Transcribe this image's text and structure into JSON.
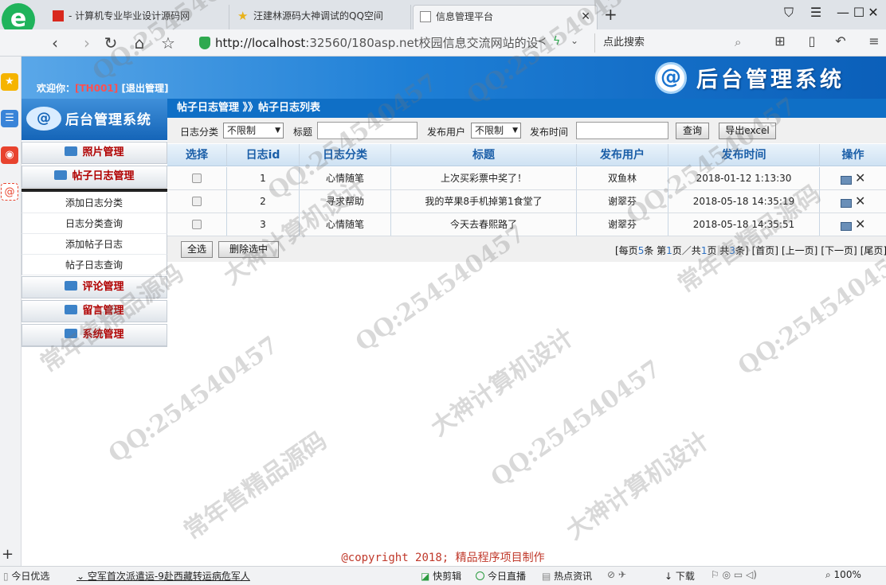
{
  "browser": {
    "tabs": [
      {
        "title": "- 计算机专业毕业设计源码网",
        "color": "#d8281d"
      },
      {
        "title": "汪建林源码大神调试的QQ空间",
        "color": "#e8b21a"
      },
      {
        "title": "信息管理平台",
        "color": "#888888"
      }
    ],
    "new_tab": "+",
    "url_host": "http://localhost",
    "url_rest": ":32560/180asp.net校园信息交流网站的设",
    "search_placeholder": "点此搜索",
    "status_items": [
      "今日优选",
      "空军首次派遣运-9赴西藏转运病危军人",
      "快剪辑",
      "今日直播",
      "热点资讯",
      "下载",
      "100%"
    ]
  },
  "header": {
    "welcome_label": "欢迎你：",
    "username": "[TH001]",
    "logout": "[退出管理]",
    "system_title": "后台管理系统",
    "logo_glyph": "@"
  },
  "sidebar": {
    "logo_title": "后台管理系统",
    "sections": [
      {
        "label": "照片管理",
        "items": []
      },
      {
        "label": "帖子日志管理",
        "items": [
          "添加日志分类",
          "日志分类查询",
          "添加帖子日志",
          "帖子日志查询"
        ]
      },
      {
        "label": "评论管理",
        "items": []
      },
      {
        "label": "留言管理",
        "items": []
      },
      {
        "label": "系统管理",
        "items": []
      }
    ]
  },
  "breadcrumb": "帖子日志管理 》》帖子日志列表",
  "filters": {
    "category_label": "日志分类",
    "category_value": "不限制",
    "title_label": "标题",
    "title_value": "",
    "user_label": "发布用户",
    "user_value": "不限制",
    "time_label": "发布时间",
    "time_value": "",
    "query_button": "查询",
    "export_button": "导出excel"
  },
  "table": {
    "headers": [
      "选择",
      "日志id",
      "日志分类",
      "标题",
      "发布用户",
      "发布时间",
      "操作"
    ],
    "rows": [
      {
        "id": "1",
        "category": "心情随笔",
        "title": "上次买彩票中奖了！",
        "user": "双鱼林",
        "time": "2018-01-12 1:13:30"
      },
      {
        "id": "2",
        "category": "寻求帮助",
        "title": "我的苹果8手机掉第1食堂了",
        "user": "谢翠芬",
        "time": "2018-05-18 14:35:19"
      },
      {
        "id": "3",
        "category": "心情随笔",
        "title": "今天去春熙路了",
        "user": "谢翠芬",
        "time": "2018-05-18 14:35:51"
      }
    ],
    "select_all": "全选",
    "delete_selected": "删除选中",
    "pager": {
      "prefix": "[每页",
      "per_page": "5",
      "mid1": "条 第",
      "current": "1",
      "mid2": "页／共",
      "total_pages": "1",
      "mid3": "页 共",
      "total": "3",
      "suffix": "条]",
      "first": "[首页]",
      "prev": "[上一页]",
      "next": "[下一页]",
      "last": "[尾页]"
    }
  },
  "copyright": "@copyright 2018; 精品程序项目制作",
  "watermarks": [
    "QQ:254540457",
    "常年售精品源码",
    "大神计算机设计"
  ]
}
